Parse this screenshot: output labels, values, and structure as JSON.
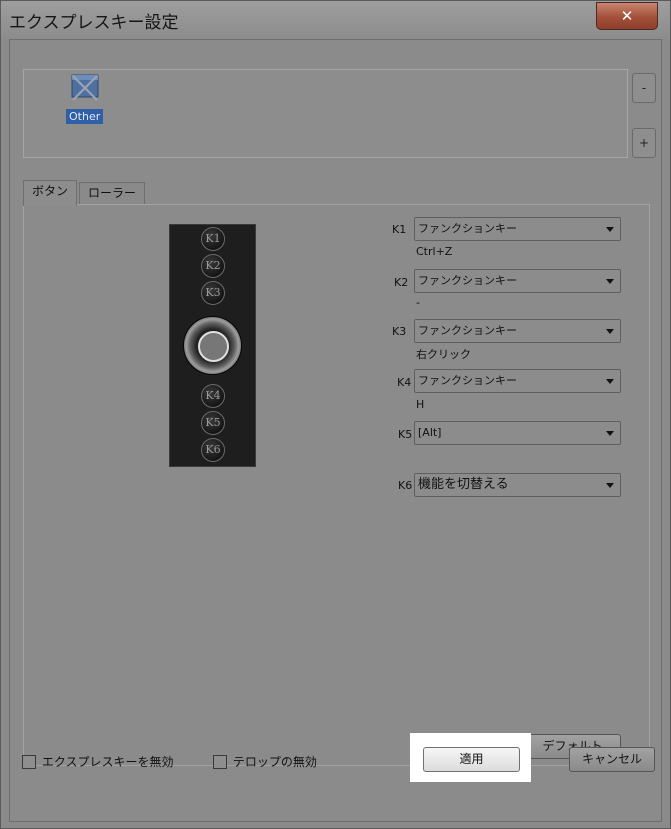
{
  "window": {
    "title": "エクスプレスキー設定",
    "close_label": "✕"
  },
  "device_list": {
    "items": [
      {
        "label": "Other",
        "icon": "application-icon"
      }
    ],
    "remove_label": "-",
    "add_label": "+"
  },
  "tabs": [
    {
      "label": "ボタン",
      "active": true
    },
    {
      "label": "ローラー",
      "active": false
    }
  ],
  "keypad": {
    "buttons": [
      "K1",
      "K2",
      "K3",
      "K4",
      "K5",
      "K6"
    ]
  },
  "keys": [
    {
      "id": "K1",
      "function": "ファンクションキー",
      "detail": "Ctrl+Z"
    },
    {
      "id": "K2",
      "function": "ファンクションキー",
      "detail": "-"
    },
    {
      "id": "K3",
      "function": "ファンクションキー",
      "detail": "右クリック"
    },
    {
      "id": "K4",
      "function": "ファンクションキー",
      "detail": "H"
    },
    {
      "id": "K5",
      "function": "[Alt]",
      "detail": ""
    },
    {
      "id": "K6",
      "function": "機能を切替える",
      "detail": ""
    }
  ],
  "buttons": {
    "default_label": "デフォルト",
    "apply_label": "適用",
    "cancel_label": "キャンセル"
  },
  "checkboxes": [
    {
      "label": "エクスプレスキーを無効",
      "checked": false
    },
    {
      "label": "テロップの無効",
      "checked": false
    }
  ]
}
